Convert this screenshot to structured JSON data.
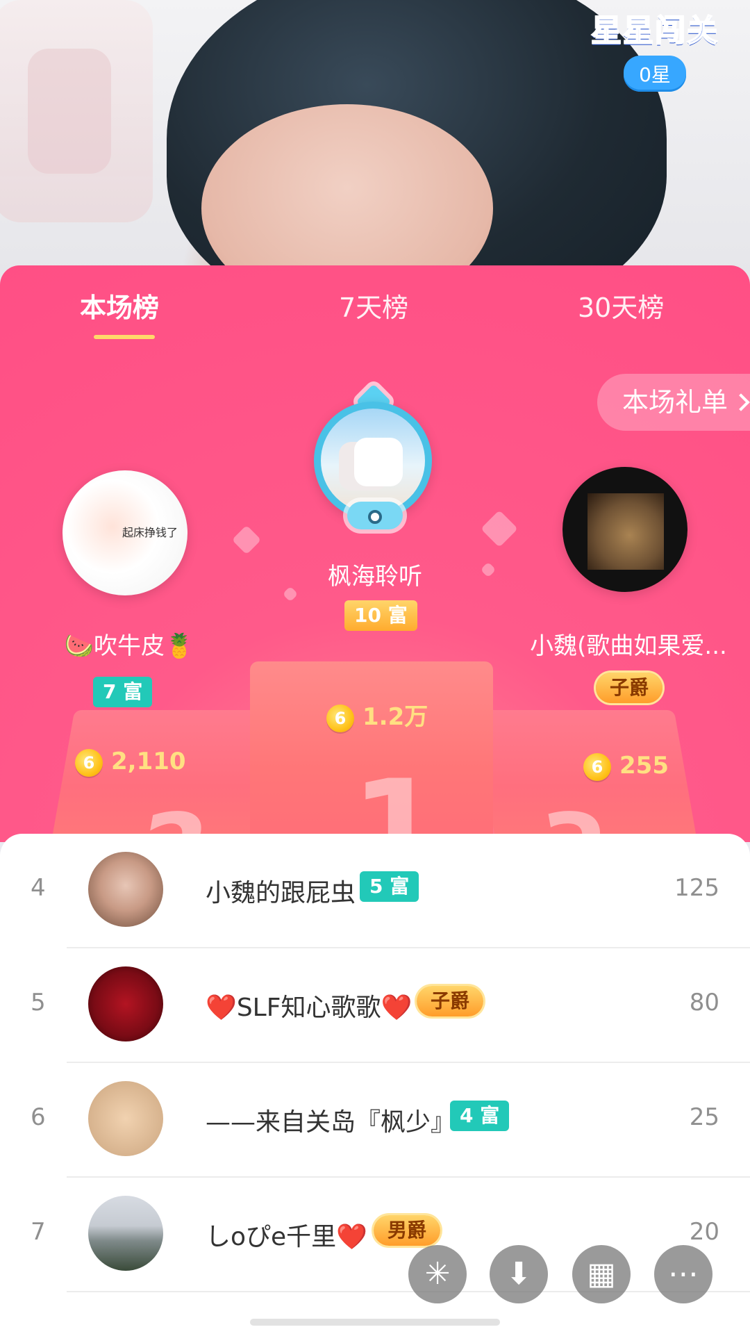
{
  "header": {
    "stars_title": "星星闯关",
    "stars_count": "0星"
  },
  "tabs": [
    {
      "label": "本场榜"
    },
    {
      "label": "7天榜"
    },
    {
      "label": "30天榜"
    }
  ],
  "gift_list": {
    "label": "本场礼单"
  },
  "podium": {
    "first": {
      "rank": "1",
      "name": "枫海聆听",
      "level": "10 富",
      "coins": "1.2万"
    },
    "second": {
      "rank": "2",
      "name": "🍉吹牛皮🍍",
      "level": "7 富",
      "coins": "2,110"
    },
    "third": {
      "rank": "3",
      "name": "小魏(歌曲如果爱...",
      "level": "子爵",
      "coins": "255"
    }
  },
  "list": [
    {
      "rank": "4",
      "name": "小魏的跟屁虫",
      "tag": "5 富",
      "value": "125"
    },
    {
      "rank": "5",
      "name": "❤️SLF知心歌歌❤️",
      "tag": "子爵",
      "value": "80"
    },
    {
      "rank": "6",
      "name": "——来自关岛『枫少』",
      "tag": "4 富",
      "value": "25"
    },
    {
      "rank": "7",
      "name": "しoぴe千里❤️",
      "tag": "男爵",
      "value": "20"
    }
  ],
  "icons": {
    "coin_icon": "coin-icon",
    "fab": [
      "shake-icon",
      "download-icon",
      "grid-icon",
      "more-icon"
    ]
  },
  "colors": {
    "panel_pink": "#ff4f85",
    "teal": "#22c9b8",
    "gold": "#ffb12e",
    "blue": "#37a7ff"
  }
}
